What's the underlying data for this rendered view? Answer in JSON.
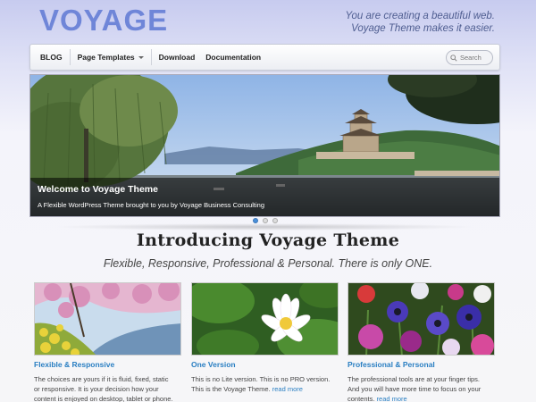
{
  "header": {
    "logo": "VOYAGE",
    "tagline_line1": "You are creating a beautiful web.",
    "tagline_line2": "Voyage Theme makes it easier."
  },
  "nav": {
    "items": [
      "BLOG",
      "Page Templates",
      "Download",
      "Documentation"
    ],
    "search_placeholder": "Search"
  },
  "slider": {
    "caption_title": "Welcome to Voyage Theme",
    "caption_text": "A Flexible WordPress Theme brought to you by Voyage Business Consulting",
    "slide_count": 3,
    "active_slide": 1
  },
  "intro": {
    "headline": "Introducing Voyage Theme",
    "subheadline": "Flexible, Responsive, Professional & Personal. There is only ONE."
  },
  "features": [
    {
      "title": "Flexible & Responsive",
      "line1": "The choices are yours if it is fluid, fixed, static",
      "line2": "or responsive. It is your decision how your",
      "line3": "content is enjoyed on desktop, tablet or phone.",
      "more": ""
    },
    {
      "title": "One Version",
      "line1": "This is no Lite version. This is no PRO version.",
      "line2": "This is the Voyage Theme.",
      "line3": "",
      "more": "read more"
    },
    {
      "title": "Professional & Personal",
      "line1": "The professional tools are at your finger tips.",
      "line2": "And you will have more time to focus on your",
      "line3": "contents.",
      "more": "read more"
    }
  ],
  "colors": {
    "logo": "#6f86d8",
    "link": "#2a7fc2",
    "active_dot": "#4a8fd9"
  }
}
